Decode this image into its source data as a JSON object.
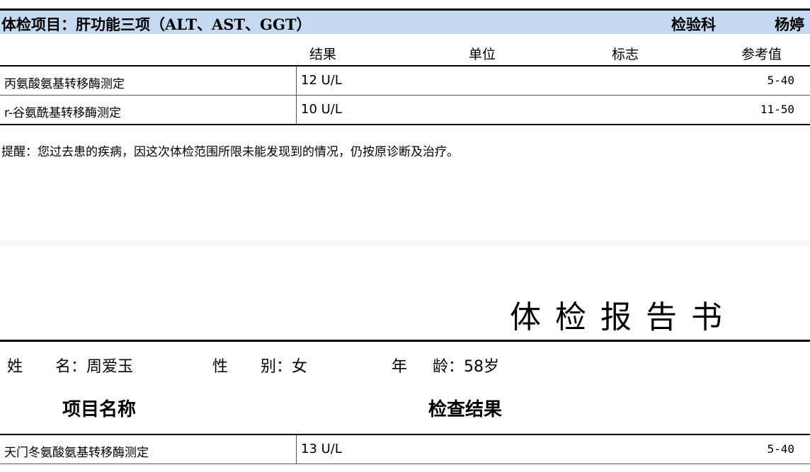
{
  "top_page": {
    "header": {
      "title": "体检项目：肝功能三项（ALT、AST、GGT）",
      "department": "检验科",
      "doctor": "杨婷"
    },
    "columns": {
      "result": "结果",
      "unit": "单位",
      "flag": "标志",
      "reference": "参考值"
    },
    "rows": [
      {
        "name": "丙氨酸氨基转移酶测定",
        "result": "12  U/L",
        "reference": "5-40"
      },
      {
        "name": "r-谷氨酰基转移酶测定",
        "result": "10  U/L",
        "reference": "11-50"
      }
    ],
    "note": "提醒：您过去患的疾病，因这次体检范围所限未能发现到的情况，仍按原诊断及治疗。"
  },
  "bottom_page": {
    "report_title": "体检报告书",
    "patient": {
      "name_label_1": "姓",
      "name_label_2": "名：",
      "name_value": "周爱玉",
      "gender_label_1": "性",
      "gender_label_2": "别：",
      "gender_value": "女",
      "age_label_1": "年",
      "age_label_2": "龄：",
      "age_value": "58岁"
    },
    "section_headers": {
      "item_name": "项目名称",
      "check_result": "检查结果"
    },
    "rows": [
      {
        "name": "天门冬氨酸氨基转移酶测定",
        "result": "13  U/L",
        "reference": "5-40"
      }
    ]
  }
}
